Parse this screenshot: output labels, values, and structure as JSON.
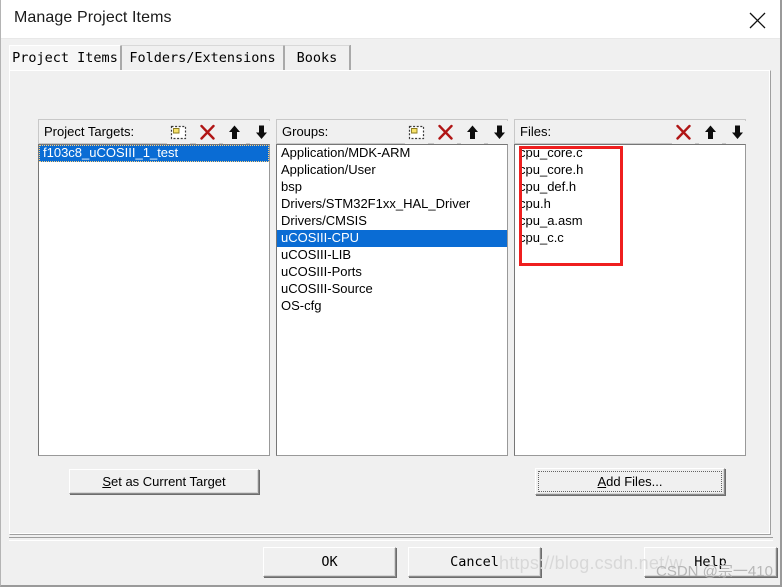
{
  "window": {
    "title": "Manage Project Items",
    "close_icon": "close-icon"
  },
  "tabs": [
    {
      "label": "Project Items",
      "active": true
    },
    {
      "label": "Folders/Extensions",
      "active": false
    },
    {
      "label": "Books",
      "active": false
    }
  ],
  "panels": {
    "targets": {
      "label": "Project Targets:",
      "tools": [
        "new-item-icon",
        "delete-icon",
        "move-up-icon",
        "move-down-icon"
      ],
      "items": [
        {
          "label": "f103c8_uCOSIII_1_test",
          "selected": true
        }
      ]
    },
    "groups": {
      "label": "Groups:",
      "tools": [
        "new-item-icon",
        "delete-icon",
        "move-up-icon",
        "move-down-icon"
      ],
      "items": [
        {
          "label": "Application/MDK-ARM",
          "selected": false
        },
        {
          "label": "Application/User",
          "selected": false
        },
        {
          "label": "bsp",
          "selected": false
        },
        {
          "label": "Drivers/STM32F1xx_HAL_Driver",
          "selected": false
        },
        {
          "label": "Drivers/CMSIS",
          "selected": false
        },
        {
          "label": "uCOSIII-CPU",
          "selected": true
        },
        {
          "label": "uCOSIII-LIB",
          "selected": false
        },
        {
          "label": "uCOSIII-Ports",
          "selected": false
        },
        {
          "label": "uCOSIII-Source",
          "selected": false
        },
        {
          "label": "OS-cfg",
          "selected": false
        }
      ]
    },
    "files": {
      "label": "Files:",
      "tools": [
        "delete-icon",
        "move-up-icon",
        "move-down-icon"
      ],
      "items": [
        {
          "label": "cpu_core.c",
          "selected": false
        },
        {
          "label": "cpu_core.h",
          "selected": false
        },
        {
          "label": "cpu_def.h",
          "selected": false
        },
        {
          "label": "cpu.h",
          "selected": false
        },
        {
          "label": "cpu_a.asm",
          "selected": false
        },
        {
          "label": "cpu_c.c",
          "selected": false
        }
      ]
    }
  },
  "actions": {
    "set_current_target": "Set as Current Target",
    "set_current_target_accel": "S",
    "add_files": "Add Files...",
    "add_files_accel": "A"
  },
  "footer": {
    "ok": "OK",
    "cancel": "Cancel",
    "help": "Help"
  },
  "watermark": {
    "url": "https://blog.csdn.net/w",
    "user": "CSDN @宗一410"
  },
  "colors": {
    "selection_blue": "#0a6cd4",
    "annotation_red": "#ef1f1f",
    "dialog_face": "#f0f0f0",
    "delete_icon_red": "#b01515"
  }
}
